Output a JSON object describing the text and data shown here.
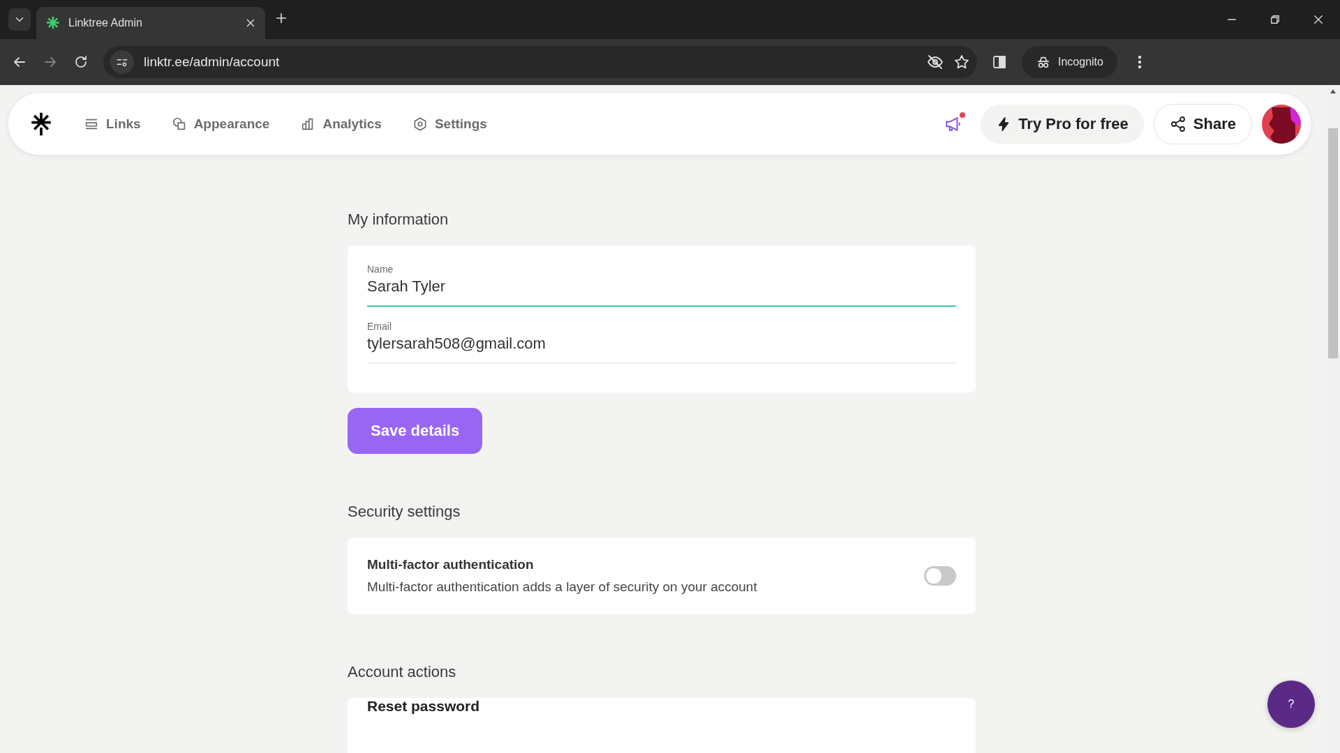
{
  "browser": {
    "tab_title": "Linktree Admin",
    "url": "linktr.ee/admin/account",
    "profile_label": "Incognito"
  },
  "nav": {
    "items": [
      {
        "label": "Links",
        "selected": false
      },
      {
        "label": "Appearance",
        "selected": false
      },
      {
        "label": "Analytics",
        "selected": false
      },
      {
        "label": "Settings",
        "selected": false
      }
    ],
    "notification_dot": true,
    "try_pro": "Try Pro for free",
    "share": "Share"
  },
  "sections": [
    {
      "kind": "form",
      "title": "My information",
      "fields": [
        {
          "label": "Name",
          "value": "Sarah Tyler",
          "focused": true
        },
        {
          "label": "Email",
          "value": "tylersarah508@gmail.com",
          "focused": false
        }
      ],
      "button": "Save details"
    },
    {
      "kind": "toggle",
      "title": "Security settings",
      "setting": {
        "title": "Multi-factor authentication",
        "description": "Multi-factor authentication adds a layer of security on your account",
        "on": false
      }
    },
    {
      "kind": "actions",
      "title": "Account actions",
      "actions": [
        "Reset password"
      ]
    }
  ],
  "help_button": "?"
}
